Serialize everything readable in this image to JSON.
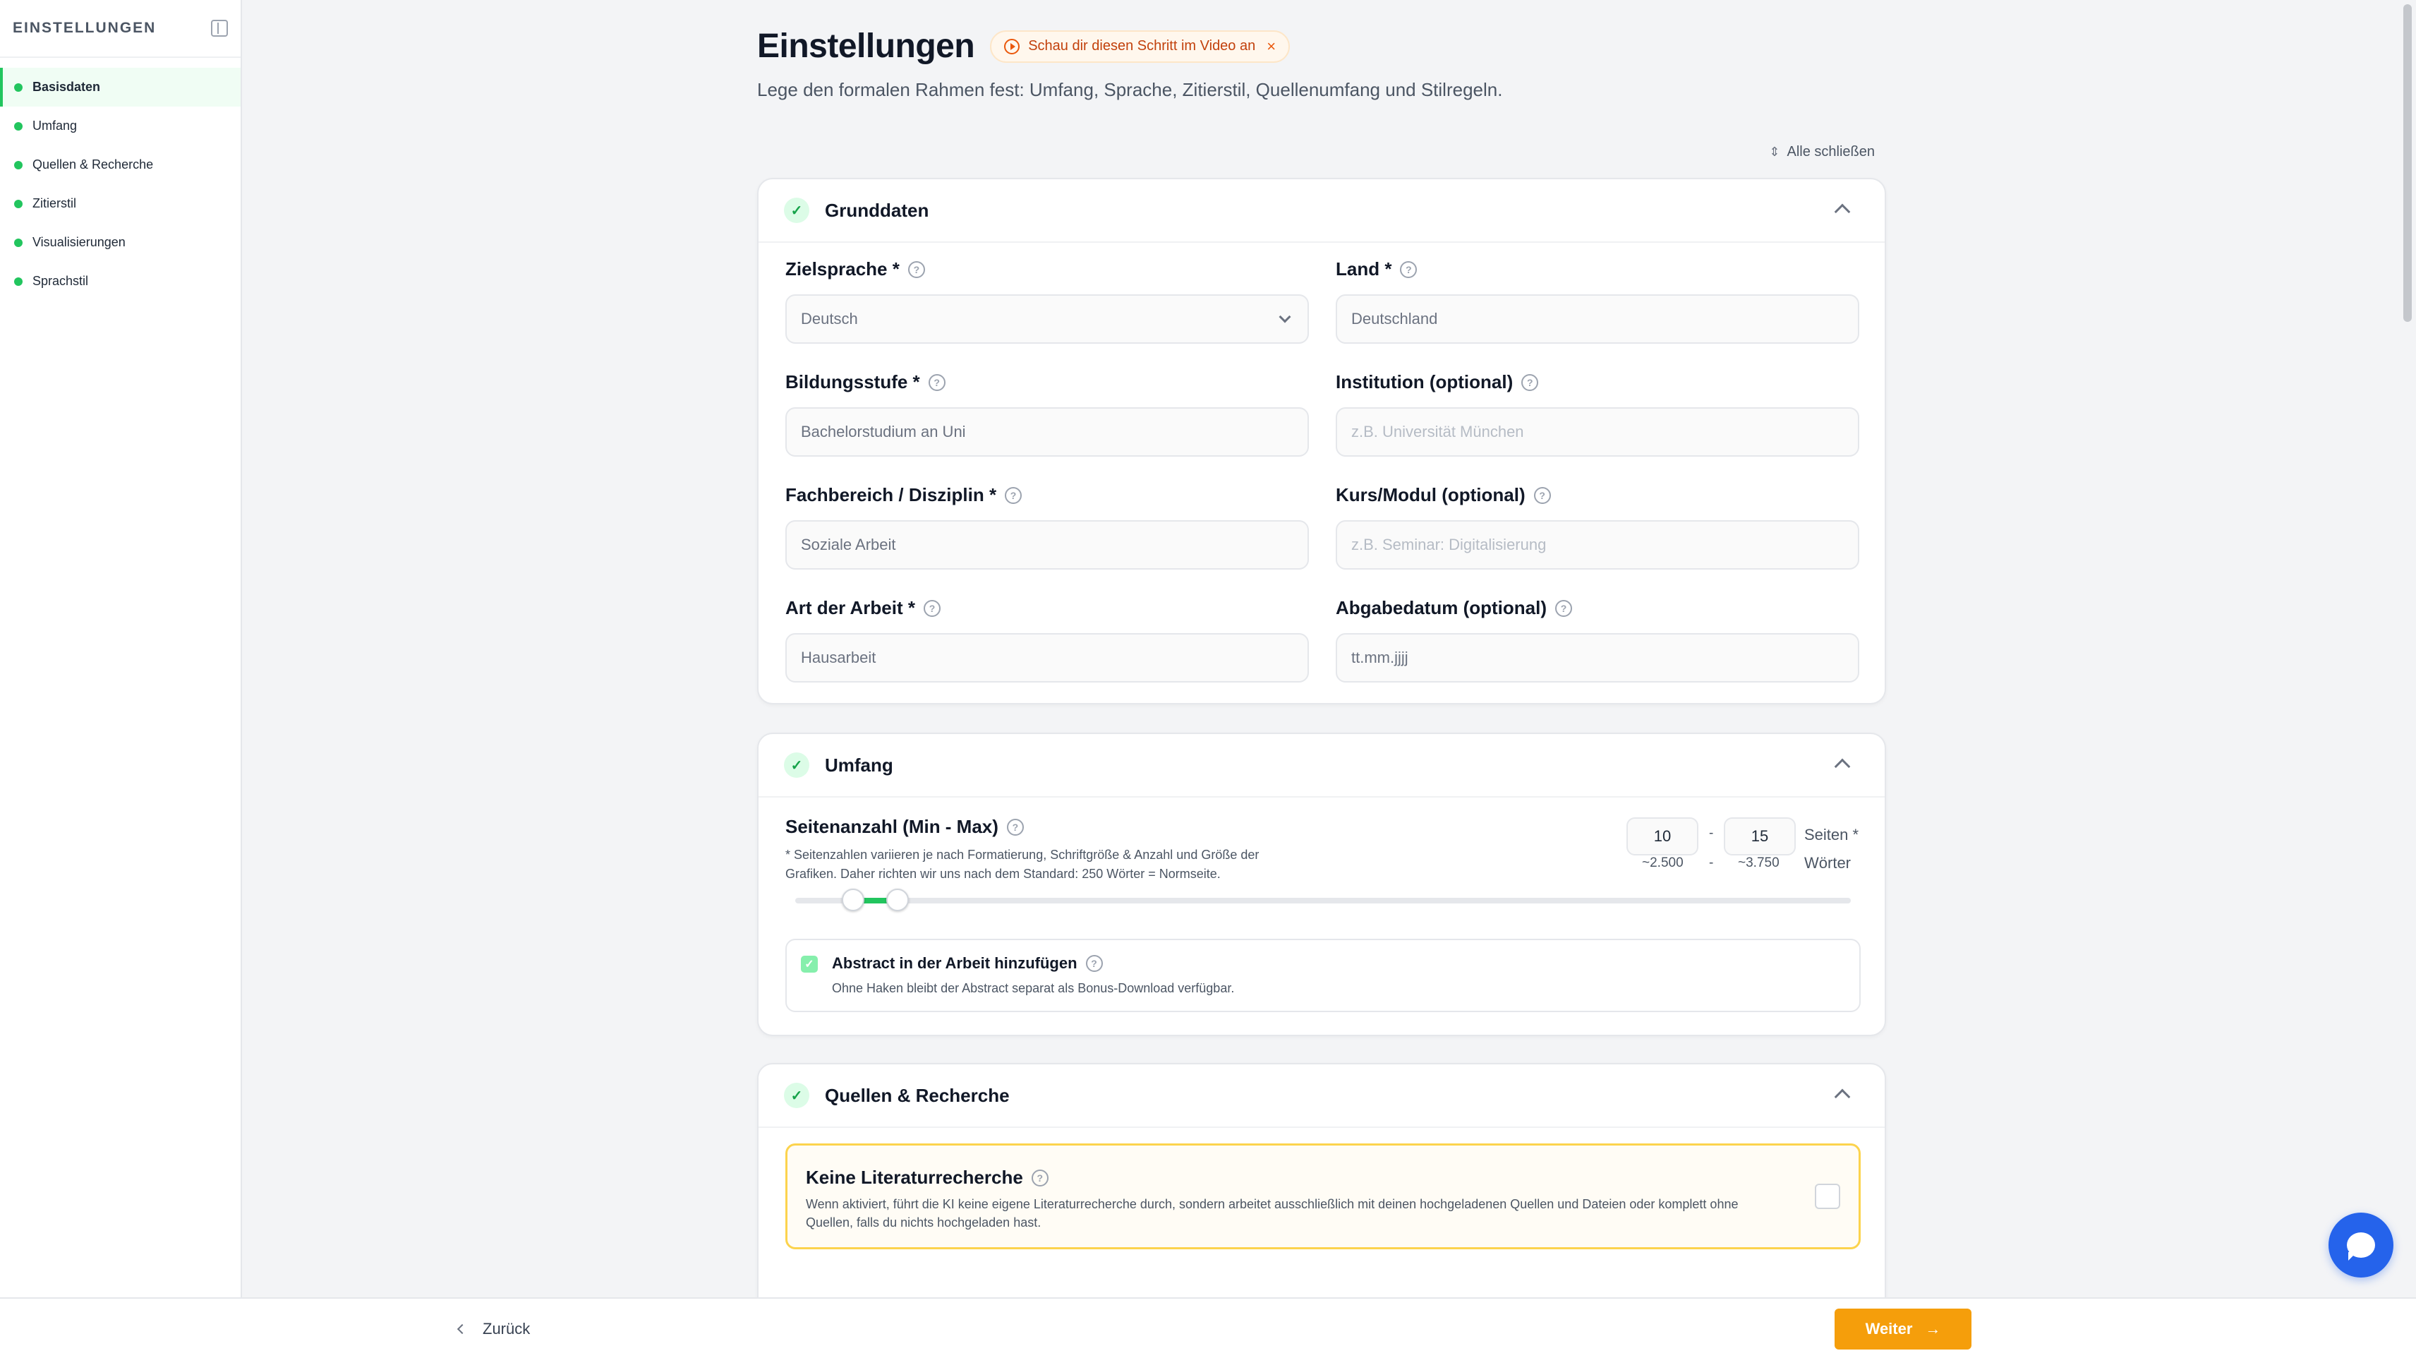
{
  "sidebar": {
    "title": "EINSTELLUNGEN",
    "items": [
      {
        "label": "Basisdaten"
      },
      {
        "label": "Umfang"
      },
      {
        "label": "Quellen & Recherche"
      },
      {
        "label": "Zitierstil"
      },
      {
        "label": "Visualisierungen"
      },
      {
        "label": "Sprachstil"
      }
    ]
  },
  "header": {
    "title": "Einstellungen",
    "video_badge": "Schau dir diesen Schritt im Video an",
    "subtitle": "Lege den formalen Rahmen fest: Umfang, Sprache, Zitierstil, Quellenumfang und Stilregeln.",
    "collapse_all": "Alle schließen"
  },
  "grunddaten": {
    "title": "Grunddaten",
    "zielsprache": {
      "label": "Zielsprache *",
      "value": "Deutsch"
    },
    "land": {
      "label": "Land *",
      "value": "Deutschland"
    },
    "bildungsstufe": {
      "label": "Bildungsstufe *",
      "value": "Bachelorstudium an Uni"
    },
    "institution": {
      "label": "Institution (optional)",
      "placeholder": "z.B. Universität München"
    },
    "fachbereich": {
      "label": "Fachbereich / Disziplin *",
      "value": "Soziale Arbeit"
    },
    "kurs": {
      "label": "Kurs/Modul (optional)",
      "placeholder": "z.B. Seminar: Digitalisierung"
    },
    "art": {
      "label": "Art der Arbeit *",
      "value": "Hausarbeit"
    },
    "abgabedatum": {
      "label": "Abgabedatum (optional)",
      "placeholder": "tt.mm.jjjj"
    }
  },
  "umfang": {
    "title": "Umfang",
    "range_label": "Seitenanzahl (Min - Max)",
    "note": "* Seitenzahlen variieren je nach Formatierung, Schriftgröße & Anzahl und Größe der Grafiken. Daher richten wir uns nach dem Standard: 250 Wörter = Normseite.",
    "min_pages": "10",
    "max_pages": "15",
    "dash": "-",
    "pages_unit": "Seiten *",
    "min_words": "~2.500",
    "max_words": "~3.750",
    "words_unit": "Wörter",
    "slider_min_fraction": 0.055,
    "slider_max_fraction": 0.097,
    "abstract_label": "Abstract in der Arbeit hinzufügen",
    "abstract_desc": "Ohne Haken bleibt der Abstract separat als Bonus-Download verfügbar.",
    "abstract_checked": true
  },
  "quellen": {
    "title": "Quellen & Recherche",
    "no_research_title": "Keine Literaturrecherche",
    "no_research_desc": "Wenn aktiviert, führt die KI keine eigene Literaturrecherche durch, sondern arbeitet ausschließlich mit deinen hochgeladenen Quellen und Dateien oder komplett ohne Quellen, falls du nichts hochgeladen hast.",
    "checked": false
  },
  "footer": {
    "back_label": "Zurück",
    "next_label": "Weiter"
  },
  "colors": {
    "accent_green": "#22c55e",
    "accent_orange": "#f59e0b",
    "chat_blue": "#2563eb"
  }
}
